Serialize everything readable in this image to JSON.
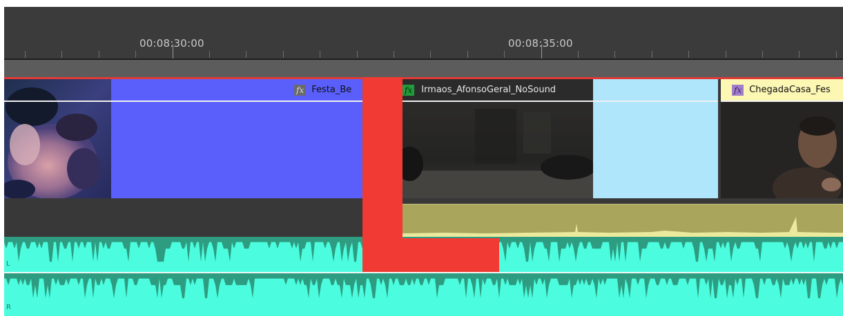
{
  "ruler": {
    "timecodes": [
      "00:08:30:00",
      "00:08:35:00"
    ]
  },
  "clips": {
    "festa": {
      "title": "Festa_Be",
      "fx": "fx"
    },
    "irmaos": {
      "title": "Irmaos_AfonsoGeral_NoSound",
      "fx": "fx"
    },
    "chegada": {
      "title": "ChegadaCasa_Fes",
      "fx": "fx"
    }
  },
  "audio": {
    "left_label": "L",
    "right_label": "R"
  },
  "colors": {
    "festa_clip": "#5a5ffc",
    "irmaos_clip": "#b0e6fb",
    "audio_clip": "#4bfcde",
    "gap_highlight": "#f23a34",
    "linked_audio": "#a9a55c",
    "ruler_bg": "#3b3b3b"
  }
}
